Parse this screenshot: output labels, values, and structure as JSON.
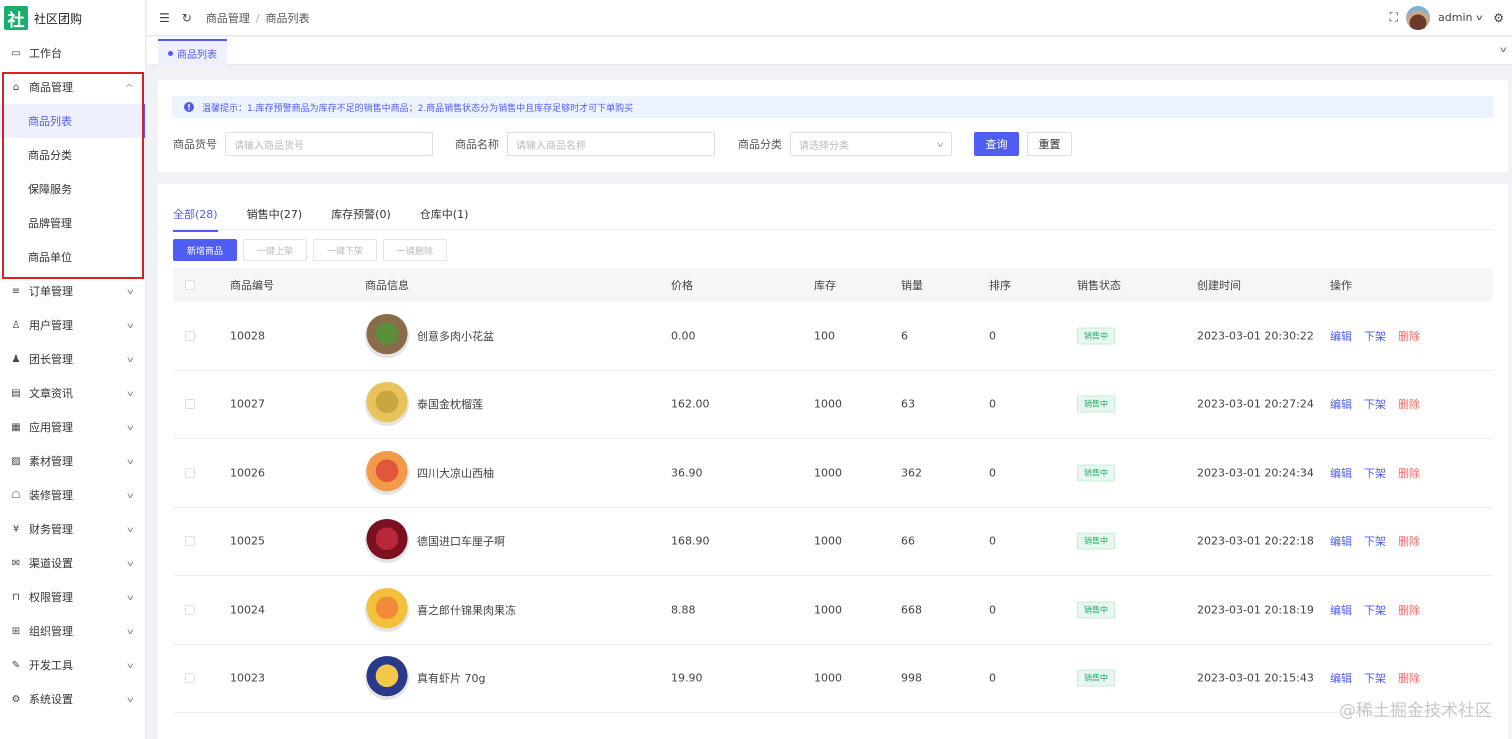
{
  "app": {
    "logo_char": "社",
    "name": "社区团购"
  },
  "sidebar": {
    "items": [
      {
        "label": "工作台",
        "icon": "monitor-icon",
        "glyph": "▭",
        "chevron": false
      },
      {
        "label": "商品管理",
        "icon": "bag-icon",
        "glyph": "⌂",
        "chevron": true,
        "expanded": true,
        "children": [
          {
            "label": "商品列表",
            "active": true
          },
          {
            "label": "商品分类"
          },
          {
            "label": "保障服务"
          },
          {
            "label": "品牌管理"
          },
          {
            "label": "商品单位"
          }
        ]
      },
      {
        "label": "订单管理",
        "icon": "list-icon",
        "glyph": "≡",
        "chevron": true
      },
      {
        "label": "用户管理",
        "icon": "user-icon",
        "glyph": "♙",
        "chevron": true
      },
      {
        "label": "团长管理",
        "icon": "person-filled-icon",
        "glyph": "♟",
        "chevron": true
      },
      {
        "label": "文章资讯",
        "icon": "message-icon",
        "glyph": "▤",
        "chevron": true
      },
      {
        "label": "应用管理",
        "icon": "grid-icon",
        "glyph": "▦",
        "chevron": true
      },
      {
        "label": "素材管理",
        "icon": "image-icon",
        "glyph": "▨",
        "chevron": true
      },
      {
        "label": "装修管理",
        "icon": "decor-icon",
        "glyph": "☖",
        "chevron": true
      },
      {
        "label": "财务管理",
        "icon": "money-icon",
        "glyph": "¥",
        "chevron": true
      },
      {
        "label": "渠道设置",
        "icon": "mail-icon",
        "glyph": "✉",
        "chevron": true
      },
      {
        "label": "权限管理",
        "icon": "lock-icon",
        "glyph": "⊓",
        "chevron": true
      },
      {
        "label": "组织管理",
        "icon": "org-icon",
        "glyph": "⊞",
        "chevron": true
      },
      {
        "label": "开发工具",
        "icon": "tool-icon",
        "glyph": "✎",
        "chevron": true
      },
      {
        "label": "系统设置",
        "icon": "settings-icon",
        "glyph": "⚙",
        "chevron": true
      }
    ]
  },
  "header": {
    "breadcrumb": [
      "商品管理",
      "商品列表"
    ],
    "user": "admin"
  },
  "page_tab": {
    "label": "商品列表"
  },
  "alert": {
    "text": "温馨提示：1.库存预警商品为库存不足的销售中商品；2.商品销售状态分为销售中且库存足够时才可下单购买"
  },
  "search": {
    "sku_label": "商品货号",
    "sku_placeholder": "请输入商品货号",
    "name_label": "商品名称",
    "name_placeholder": "请输入商品名称",
    "category_label": "商品分类",
    "category_placeholder": "请选择分类",
    "query_btn": "查询",
    "reset_btn": "重置"
  },
  "status_tabs": [
    {
      "label": "全部(28)",
      "active": true
    },
    {
      "label": "销售中(27)"
    },
    {
      "label": "库存预警(0)"
    },
    {
      "label": "仓库中(1)"
    }
  ],
  "actions": [
    {
      "label": "新增商品",
      "primary": true
    },
    {
      "label": "一键上架"
    },
    {
      "label": "一键下架"
    },
    {
      "label": "一键删除"
    }
  ],
  "table": {
    "columns": [
      "商品编号",
      "商品信息",
      "价格",
      "库存",
      "销量",
      "排序",
      "销售状态",
      "创建时间",
      "操作"
    ],
    "ops": [
      "编辑",
      "下架",
      "删除"
    ],
    "rows": [
      {
        "id": "10028",
        "name": "创意多肉小花盆",
        "price": "0.00",
        "stock": "100",
        "sales": "6",
        "sort": "0",
        "status": "销售中",
        "created": "2023-03-01 20:30:22",
        "img_colors": [
          "#8a6b4a",
          "#5a8f3a"
        ]
      },
      {
        "id": "10027",
        "name": "泰国金枕榴莲",
        "price": "162.00",
        "stock": "1000",
        "sales": "63",
        "sort": "0",
        "status": "销售中",
        "created": "2023-03-01 20:27:24",
        "img_colors": [
          "#e8c25a",
          "#caa640"
        ]
      },
      {
        "id": "10026",
        "name": "四川大凉山西柚",
        "price": "36.90",
        "stock": "1000",
        "sales": "362",
        "sort": "0",
        "status": "销售中",
        "created": "2023-03-01 20:24:34",
        "img_colors": [
          "#f29a4a",
          "#e2563a"
        ]
      },
      {
        "id": "10025",
        "name": "德国进口车厘子啊",
        "price": "168.90",
        "stock": "1000",
        "sales": "66",
        "sort": "0",
        "status": "销售中",
        "created": "2023-03-01 20:22:18",
        "img_colors": [
          "#7a1020",
          "#b8283a"
        ]
      },
      {
        "id": "10024",
        "name": "喜之郎什锦果肉果冻",
        "price": "8.88",
        "stock": "1000",
        "sales": "668",
        "sort": "0",
        "status": "销售中",
        "created": "2023-03-01 20:18:19",
        "img_colors": [
          "#f2c03a",
          "#f28a3a"
        ]
      },
      {
        "id": "10023",
        "name": "真有虾片 70g",
        "price": "19.90",
        "stock": "1000",
        "sales": "998",
        "sort": "0",
        "status": "销售中",
        "created": "2023-03-01 20:15:43",
        "img_colors": [
          "#2a3a8a",
          "#f2c84a"
        ]
      }
    ]
  },
  "watermark": "@稀土掘金技术社区"
}
